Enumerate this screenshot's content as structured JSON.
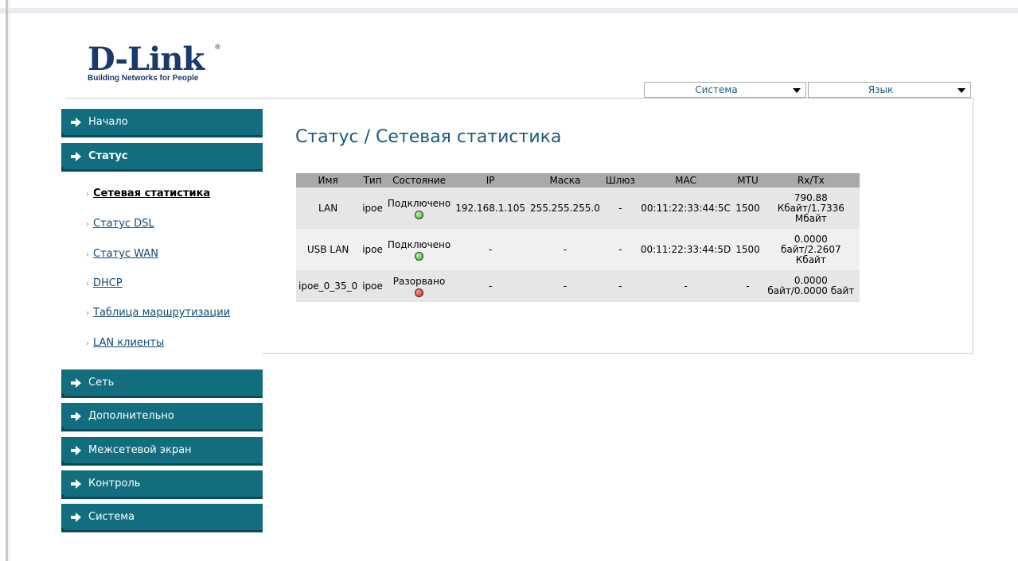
{
  "brand": {
    "logo_text": "D-Link",
    "logo_mark": "®",
    "tagline": "Building Networks for People"
  },
  "top_dropdowns": {
    "system_label": "Система",
    "language_label": "Язык"
  },
  "menu": {
    "items": [
      {
        "label": "Начало"
      },
      {
        "label": "Статус"
      },
      {
        "label": "Сеть"
      },
      {
        "label": "Дополнительно"
      },
      {
        "label": "Межсетевой экран"
      },
      {
        "label": "Контроль"
      },
      {
        "label": "Система"
      }
    ],
    "status_submenu": [
      {
        "label": "Сетевая статистика",
        "active": true
      },
      {
        "label": "Статус DSL"
      },
      {
        "label": "Статус WAN"
      },
      {
        "label": "DHCP"
      },
      {
        "label": "Таблица маршрутизации"
      },
      {
        "label": "LAN клиенты"
      }
    ]
  },
  "page": {
    "title": "Статус / Сетевая статистика"
  },
  "table": {
    "headers": [
      "Имя",
      "Тип",
      "Состояние",
      "IP",
      "Маска",
      "Шлюз",
      "MAC",
      "MTU",
      "Rx/Tx"
    ],
    "rows": [
      {
        "name": "LAN",
        "type": "ipoe",
        "state": "Подключено",
        "state_color": "#3aa82a",
        "ip": "192.168.1.105",
        "mask": "255.255.255.0",
        "gateway": "-",
        "mac": "00:11:22:33:44:5C",
        "mtu": "1500",
        "rxtx": "790.88 Кбайт/1.7336 Мбайт"
      },
      {
        "name": "USB LAN",
        "type": "ipoe",
        "state": "Подключено",
        "state_color": "#3aa82a",
        "ip": "-",
        "mask": "-",
        "gateway": "-",
        "mac": "00:11:22:33:44:5D",
        "mtu": "1500",
        "rxtx": "0.0000 байт/2.2607 Кбайт"
      },
      {
        "name": "ipoe_0_35_0",
        "type": "ipoe",
        "state": "Разорвано",
        "state_color": "#d81e10",
        "ip": "-",
        "mask": "-",
        "gateway": "-",
        "mac": "-",
        "mtu": "-",
        "rxtx": "0.0000 байт/0.0000 байт"
      }
    ]
  },
  "colors": {
    "menu_bg": "#126e7e",
    "title": "#1a5a7a",
    "link": "#124a70"
  }
}
